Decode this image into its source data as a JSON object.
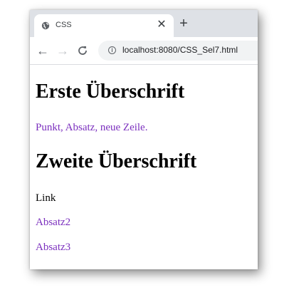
{
  "tab": {
    "title": "CSS"
  },
  "toolbar": {
    "url": "localhost:8080/CSS_Sel7.html"
  },
  "page": {
    "heading1": "Erste Überschrift",
    "paragraph1": "Punkt, Absatz, neue Zeile.",
    "heading2": "Zweite Überschrift",
    "link1": "Link",
    "link2": "Absatz2",
    "link3": "Absatz3"
  },
  "colors": {
    "visited_link": "#7b2fbe",
    "tabstrip": "#dee1e6",
    "omnibox": "#f1f3f4"
  },
  "icons": [
    "favicon-globe-icon",
    "close-icon",
    "new-tab-icon",
    "back-arrow-icon",
    "forward-arrow-icon",
    "reload-icon",
    "info-icon"
  ]
}
